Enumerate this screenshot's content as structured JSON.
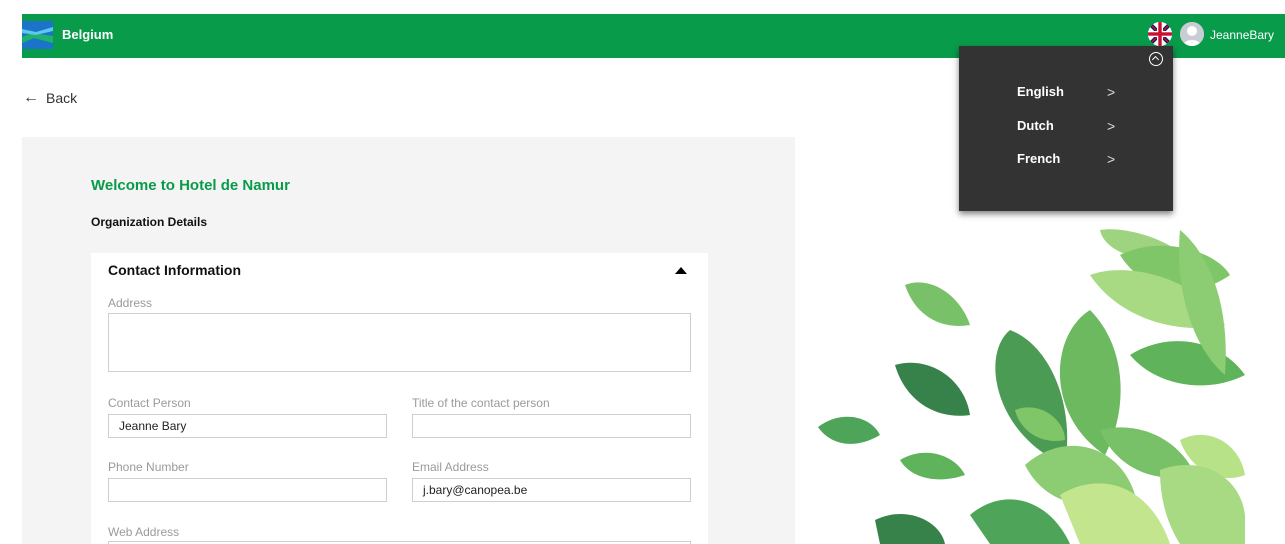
{
  "header": {
    "brand": "Belgium",
    "username": "JeanneBary",
    "language_icon": "uk-flag-icon",
    "avatar_icon": "user-avatar-icon",
    "bar_color": "#089b4a"
  },
  "nav": {
    "back_label": "Back",
    "back_icon": "arrow-left-icon"
  },
  "main": {
    "welcome": "Welcome to Hotel de Namur",
    "section": "Organization Details",
    "card": {
      "title": "Contact Information",
      "fields": {
        "address": {
          "label": "Address",
          "value": ""
        },
        "contact_person": {
          "label": "Contact Person",
          "value": "Jeanne Bary"
        },
        "contact_title": {
          "label": "Title of the contact person",
          "value": ""
        },
        "phone": {
          "label": "Phone Number",
          "value": ""
        },
        "email": {
          "label": "Email Address",
          "value": "j.bary@canopea.be"
        },
        "web": {
          "label": "Web Address",
          "value": ""
        }
      }
    }
  },
  "language_menu": {
    "items": [
      {
        "label": "English"
      },
      {
        "label": "Dutch"
      },
      {
        "label": "French"
      }
    ]
  }
}
